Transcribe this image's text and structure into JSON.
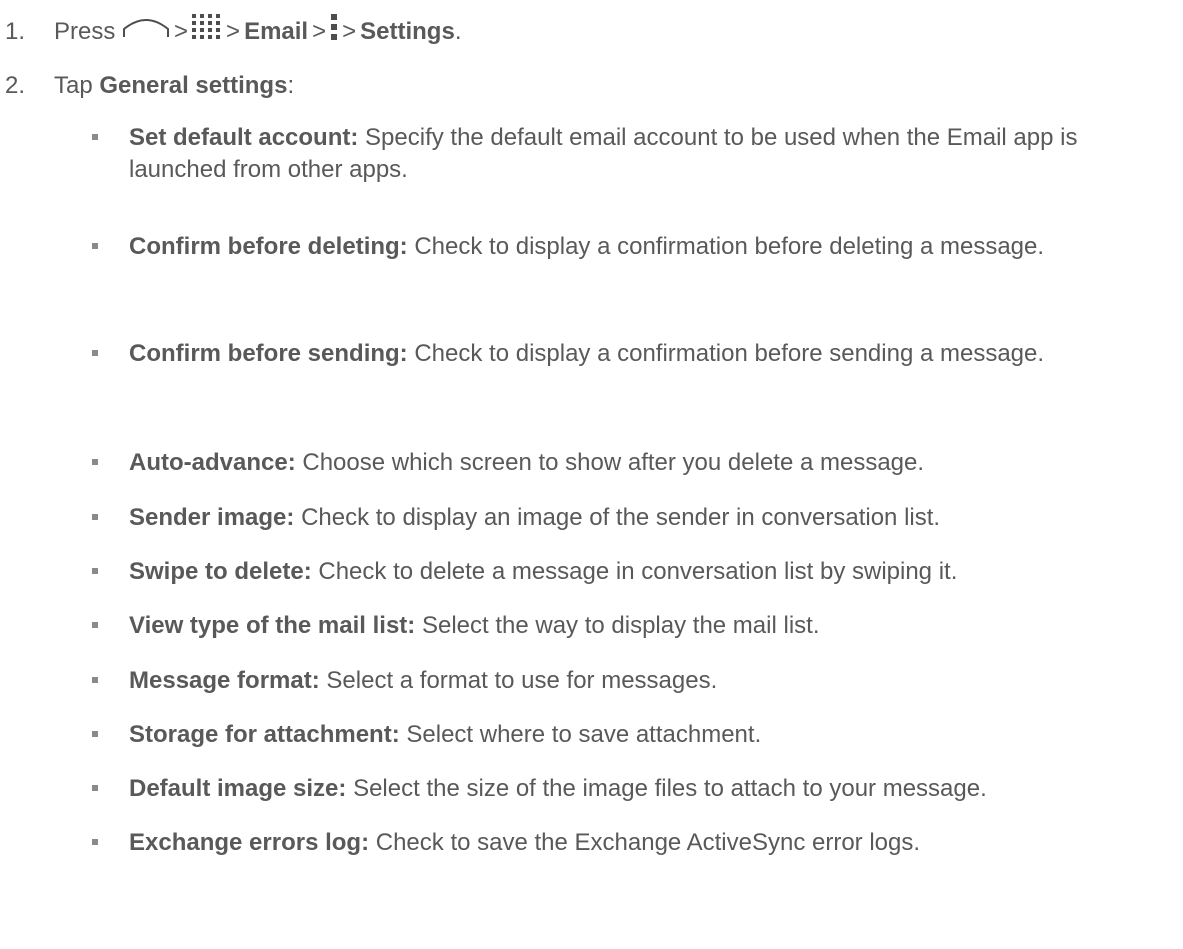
{
  "steps": [
    {
      "number": "1.",
      "press": "Press",
      "sep": ">",
      "email": "Email",
      "settings": "Settings",
      "end": ".",
      "icons": [
        "home-icon",
        "apps-icon",
        "menu-icon"
      ]
    },
    {
      "number": "2.",
      "tap": "Tap",
      "general": "General settings",
      "colon": ":"
    }
  ],
  "items": [
    {
      "term": "Set default account:",
      "desc": "Specify the default email account to be used when the Email app is launched from other apps."
    },
    {
      "term": "Confirm before deleting:",
      "desc": "Check to display a confirmation before deleting a message."
    },
    {
      "term": "Confirm before sending:",
      "desc": "Check to display a confirmation before sending a message."
    },
    {
      "term": "Auto-advance:",
      "desc": "Choose which screen to show after you delete a message."
    },
    {
      "term": "Sender image:",
      "desc": "Check to display an image of the sender in conversation list."
    },
    {
      "term": "Swipe to delete:",
      "desc": "Check to delete a message in conversation list by swiping it."
    },
    {
      "term": "View type of the mail list:",
      "desc": "Select the way to display the mail list."
    },
    {
      "term": "Message format:",
      "desc": "Select a format to use for messages."
    },
    {
      "term": "Storage for attachment:",
      "desc": "Select where to save attachment."
    },
    {
      "term": "Default image size:",
      "desc": "Select the size of the image files to attach to your message."
    },
    {
      "term": "Exchange errors log:",
      "desc": "Check to save the Exchange ActiveSync error logs."
    }
  ]
}
